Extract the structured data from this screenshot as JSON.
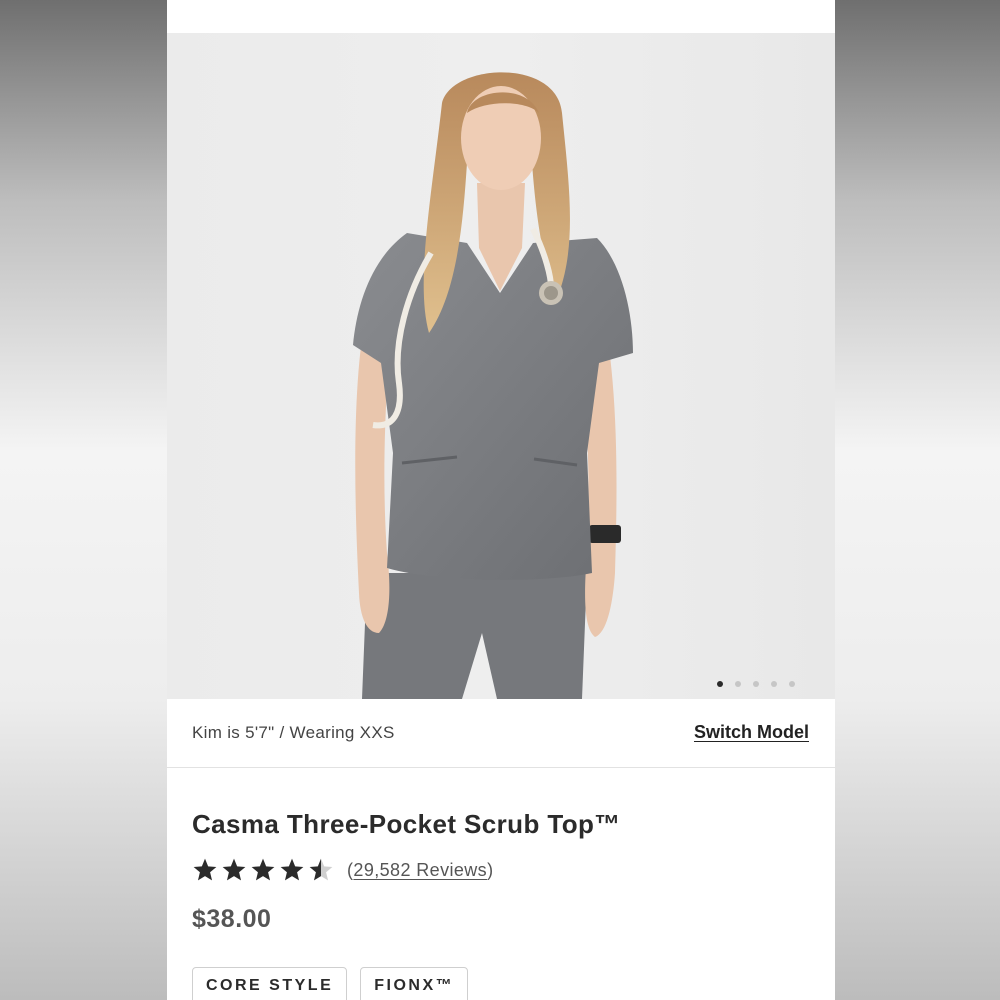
{
  "product": {
    "model_info": "Kim is 5'7\" / Wearing XXS",
    "switch_model_label": "Switch Model",
    "title": "Casma Three-Pocket Scrub Top™",
    "rating": {
      "stars": 4.5,
      "max": 5,
      "reviews_open": "(",
      "reviews_count": "29,582 Reviews",
      "reviews_close": ")"
    },
    "price": "$38.00",
    "tags": [
      "CORE STYLE",
      "FIONX™"
    ],
    "image": {
      "alt": "model-wearing-scrub-top-photo",
      "slides": 5,
      "active_slide": 1,
      "scrub_color": "#7a7c80"
    }
  },
  "colors": {
    "star": "#2b2b2b",
    "star_empty": "#cfcfcf",
    "text": "#2b2b2b"
  }
}
